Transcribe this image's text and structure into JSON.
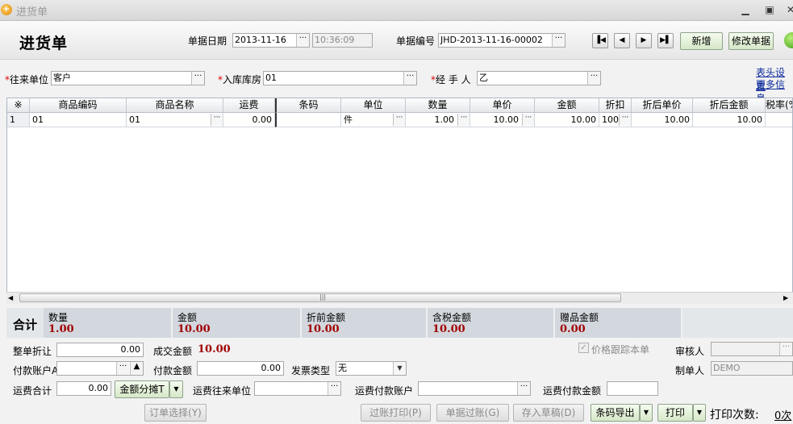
{
  "window": {
    "title": "进货单",
    "min_icon": "minimize-icon",
    "max_icon": "maximize-icon",
    "close_icon": "close-icon"
  },
  "header": {
    "title": "进货单",
    "date_label": "单据日期",
    "date_value": "2013-11-16",
    "time_value": "10:36:09",
    "docno_label": "单据编号",
    "docno_value": "JHD-2013-11-16-00002",
    "nav": [
      "first-icon",
      "prev-icon",
      "next-icon",
      "last-icon"
    ],
    "new_label": "新增",
    "edit_label": "修改单据"
  },
  "form": {
    "partner_label": "往来单位",
    "partner_value": "客户",
    "warehouse_label": "入库库房",
    "warehouse_value": "01",
    "handler_label": "经 手 人",
    "handler_value": "乙",
    "link_header": "表头设置",
    "link_more": "更多信息"
  },
  "grid": {
    "columns": [
      "※",
      "商品编码",
      "商品名称",
      "运费",
      "条码",
      "单位",
      "数量",
      "单价",
      "金额",
      "折扣",
      "折后单价",
      "折后金额",
      "税率(%"
    ],
    "rows": [
      {
        "no": "1",
        "code": "01",
        "name": "01",
        "freight": "0.00",
        "barcode": "",
        "unit": "件",
        "qty": "1.00",
        "price": "10.00",
        "amount": "10.00",
        "discount": "100",
        "disc_price": "10.00",
        "disc_amount": "10.00",
        "tax": ""
      }
    ]
  },
  "summary": {
    "label": "合计",
    "items": [
      {
        "title": "数量",
        "value": "1.00"
      },
      {
        "title": "金额",
        "value": "10.00"
      },
      {
        "title": "折前金额",
        "value": "10.00"
      },
      {
        "title": "含税金额",
        "value": "10.00"
      },
      {
        "title": "赠品金额",
        "value": "0.00"
      }
    ]
  },
  "footer": {
    "discount_label": "整单折让",
    "discount_value": "0.00",
    "deal_label": "成交金额",
    "deal_value": "10.00",
    "price_track_label": "价格跟踪本单",
    "auditor_label": "审核人",
    "auditor_value": "",
    "account_label": "付款账户A",
    "account_value": "",
    "pay_label": "付款金额",
    "pay_value": "0.00",
    "invoice_label": "发票类型",
    "invoice_value": "无",
    "maker_label": "制单人",
    "maker_value": "DEMO",
    "freight_total_label": "运费合计",
    "freight_total_value": "0.00",
    "split_label": "金额分摊T",
    "freight_partner_label": "运费往来单位",
    "freight_partner_value": "",
    "freight_account_label": "运费付款账户",
    "freight_account_value": "",
    "freight_pay_label": "运费付款金额",
    "freight_pay_value": "",
    "order_select_label": "订单选择(Y)",
    "post_print_label": "过账打印(P)",
    "post_label": "单据过账(G)",
    "draft_label": "存入草稿(D)",
    "barcode_export_label": "条码导出",
    "print_label": "打印",
    "print_count_label": "打印次数:",
    "print_count_value": "0次"
  }
}
